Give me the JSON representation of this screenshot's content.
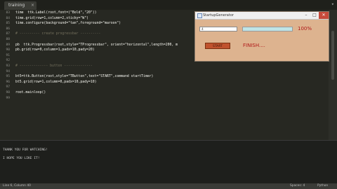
{
  "editor_tab": {
    "label": "training",
    "close": "×"
  },
  "tabbar_more": "▾",
  "code_lines": [
    {
      "num": "83",
      "text": "time  ttk.Label(root,font=(\"Bold\",\"20\"))",
      "kind": "code"
    },
    {
      "num": "84",
      "text": "time.grid(row=1,column=2,sticky=\"W\")",
      "kind": "code"
    },
    {
      "num": "85",
      "text": "time.configure(background=\"tan\",foreground=\"maroon\")",
      "kind": "code"
    },
    {
      "num": "86",
      "text": "",
      "kind": "code"
    },
    {
      "num": "87",
      "text": "# ---------- create progressbar ----------",
      "kind": "comment"
    },
    {
      "num": "88",
      "text": "",
      "kind": "code"
    },
    {
      "num": "89",
      "text": "pb  ttk.Progressbar(root,style=\"TProgressbar\", orient=\"horizontal\",length=200, m",
      "kind": "code"
    },
    {
      "num": "90",
      "text": "pb.grid(row=0,column=1,padx=10,pady=20)",
      "kind": "code"
    },
    {
      "num": "91",
      "text": "",
      "kind": "code"
    },
    {
      "num": "92",
      "text": "",
      "kind": "code"
    },
    {
      "num": "93",
      "text": "# -------------- button --------------",
      "kind": "comment"
    },
    {
      "num": "94",
      "text": "",
      "kind": "code"
    },
    {
      "num": "95",
      "text": "bt5=ttk.Button(root,style=\"TButton\",text=\"START\",command startTimer)",
      "kind": "code"
    },
    {
      "num": "96",
      "text": "bt5.grid(row=1,column=0,padx=10,pady=10)",
      "kind": "code"
    },
    {
      "num": "97",
      "text": "",
      "kind": "code"
    },
    {
      "num": "98",
      "text": "root.mainloop()",
      "kind": "code"
    },
    {
      "num": "99",
      "text": "",
      "kind": "code"
    }
  ],
  "console": {
    "line1": "THANK YOU FOR WATCHING!",
    "line2": "I HOPE YOU LIKE IT!"
  },
  "statusbar": {
    "left": "Line 6, Column 40",
    "mid": "Spaces: 4",
    "right": "Python"
  },
  "tk_window": {
    "title": "StartupGenerator",
    "minimize": "–",
    "maximize": "□",
    "close": "✕",
    "entry_value": "4",
    "progress_percent": 100,
    "percent_label": "100%",
    "button_label": "START",
    "finish_label": "FINISH....",
    "colors": {
      "window_bg": "#ddb38f",
      "progress_fill": "#bfe4e6",
      "accent_text": "#b01818",
      "button_bg": "#c0522e"
    }
  },
  "colors": {
    "editor_bg": "#272822",
    "console_bg": "#1e1f1c",
    "comment": "#75715e"
  }
}
